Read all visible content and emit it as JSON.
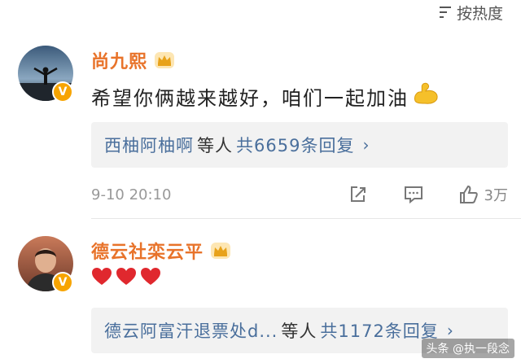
{
  "sort": {
    "label": "按热度",
    "icon": "sort-icon"
  },
  "comments": [
    {
      "author": "尚九熙",
      "text": "希望你俩越来越好，咱们一起加油",
      "emoji": "muscle-emoji",
      "reply_names": "西柚阿柚啊",
      "reply_mid": "等人",
      "reply_count": "共6659条回复",
      "timestamp": "9-10 20:10",
      "likes": "3万"
    },
    {
      "author": "德云社栾云平",
      "hearts": [
        "❤",
        "❤",
        "❤"
      ],
      "reply_names": "德云阿富汗退票处d...",
      "reply_mid": "等人",
      "reply_count": "共1172条回复"
    }
  ],
  "colors": {
    "author": "#e8732a",
    "link": "#4a6f9c",
    "badge": "#f7a400"
  },
  "watermark": "头条 @执一段念"
}
